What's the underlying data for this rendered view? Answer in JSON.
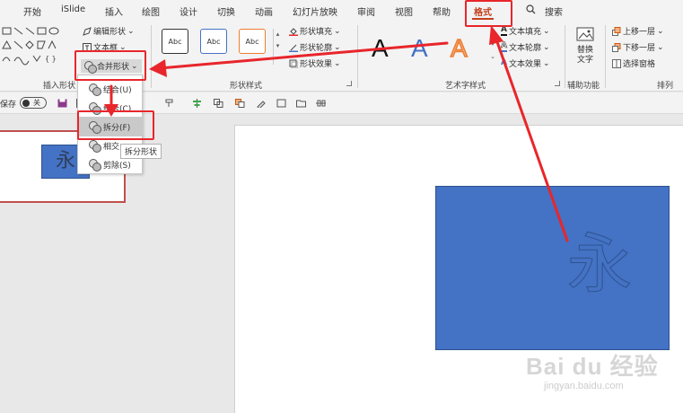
{
  "tabs": [
    {
      "label": "开始"
    },
    {
      "label": "iSlide"
    },
    {
      "label": "插入"
    },
    {
      "label": "绘图"
    },
    {
      "label": "设计"
    },
    {
      "label": "切换"
    },
    {
      "label": "动画"
    },
    {
      "label": "幻灯片放映"
    },
    {
      "label": "审阅"
    },
    {
      "label": "视图"
    },
    {
      "label": "帮助"
    },
    {
      "label": "格式"
    }
  ],
  "search_label": "搜索",
  "ribbon": {
    "edit_shape": "编辑形状",
    "text_box": "文本框",
    "merge_shapes": "合并形状",
    "insert_shapes_label": "插入形状",
    "shape_styles": {
      "label": "形状样式",
      "swatch_text": "Abc",
      "fill": "形状填充",
      "outline": "形状轮廓",
      "effects": "形状效果"
    },
    "wordart": {
      "label": "艺术字样式",
      "glyph": "A",
      "text_fill": "文本填充",
      "text_outline": "文本轮廓",
      "text_effects": "文本效果"
    },
    "accessibility": {
      "label": "辅助功能",
      "alt_text_1": "替换",
      "alt_text_2": "文字"
    },
    "arrange": {
      "label": "排列",
      "bring_forward": "上移一层",
      "send_backward": "下移一层",
      "selection_pane": "选择窗格"
    }
  },
  "quickbar": {
    "autosave": "保存",
    "toggle_state": "关"
  },
  "merge_menu": {
    "items": [
      {
        "label": "结合(U)"
      },
      {
        "label": "组合(C)"
      },
      {
        "label": "拆分(F)"
      },
      {
        "label": "相交"
      },
      {
        "label": "剪除(S)"
      }
    ],
    "tooltip": "拆分形状"
  },
  "slide": {
    "shape_char": "永"
  },
  "watermark": {
    "brand": "Bai du 经验",
    "url": "jingyan.baidu.com"
  },
  "colors": {
    "accent": "#c43e1c",
    "shape_fill": "#4472c4",
    "annotation_red": "#e8262b"
  }
}
